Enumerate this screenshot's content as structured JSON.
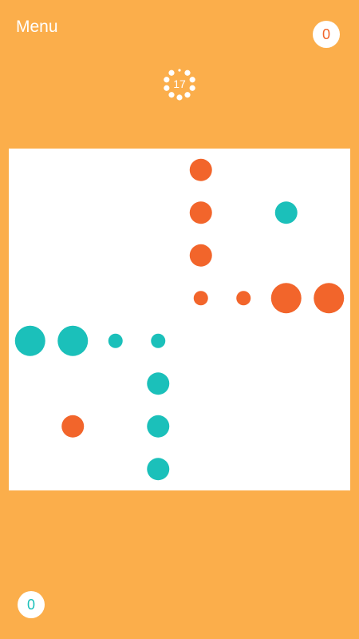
{
  "menu": {
    "label": "Menu"
  },
  "scores": {
    "top": "0",
    "bottom": "0"
  },
  "timer": {
    "value": "17"
  },
  "colors": {
    "background": "#FBAE4B",
    "player_orange": "#F2652B",
    "player_teal": "#1BC0BA",
    "board": "#FFFFFF"
  },
  "board": {
    "grid_cols": 8,
    "grid_rows": 8,
    "dots": [
      {
        "col": 4,
        "row": 0,
        "player": "orange",
        "level": 2
      },
      {
        "col": 4,
        "row": 1,
        "player": "orange",
        "level": 2
      },
      {
        "col": 6,
        "row": 1,
        "player": "teal",
        "level": 2
      },
      {
        "col": 4,
        "row": 2,
        "player": "orange",
        "level": 2
      },
      {
        "col": 4,
        "row": 3,
        "player": "orange",
        "level": 1
      },
      {
        "col": 5,
        "row": 3,
        "player": "orange",
        "level": 1
      },
      {
        "col": 6,
        "row": 3,
        "player": "orange",
        "level": 3
      },
      {
        "col": 7,
        "row": 3,
        "player": "orange",
        "level": 3
      },
      {
        "col": 0,
        "row": 4,
        "player": "teal",
        "level": 3
      },
      {
        "col": 1,
        "row": 4,
        "player": "teal",
        "level": 3
      },
      {
        "col": 2,
        "row": 4,
        "player": "teal",
        "level": 1
      },
      {
        "col": 3,
        "row": 4,
        "player": "teal",
        "level": 1
      },
      {
        "col": 3,
        "row": 5,
        "player": "teal",
        "level": 2
      },
      {
        "col": 1,
        "row": 6,
        "player": "orange",
        "level": 2
      },
      {
        "col": 3,
        "row": 6,
        "player": "teal",
        "level": 2
      },
      {
        "col": 3,
        "row": 7,
        "player": "teal",
        "level": 2
      }
    ]
  }
}
